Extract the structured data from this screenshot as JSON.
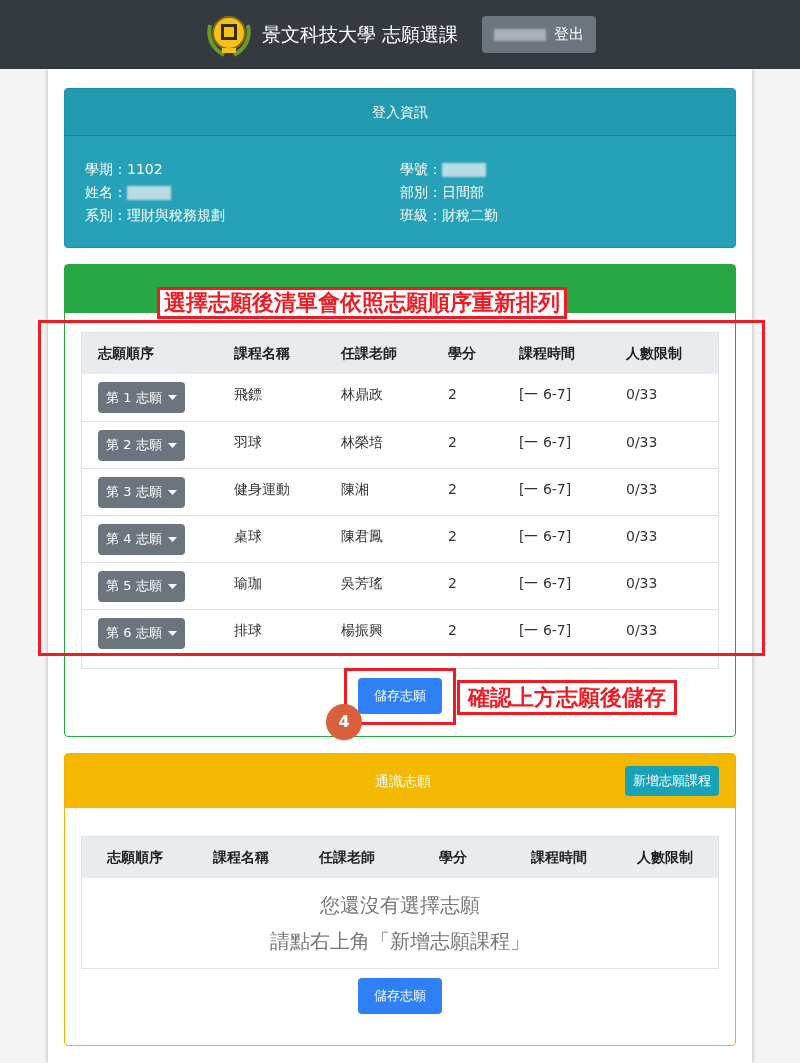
{
  "navbar": {
    "title": "景文科技大學 志願選課",
    "logout_label": "登出"
  },
  "login_info": {
    "title": "登入資訊",
    "fields": [
      {
        "label": "學期：",
        "value": "1102"
      },
      {
        "label": "學號："
      },
      {
        "label": "姓名："
      },
      {
        "label": "部別：",
        "value": "日間部"
      },
      {
        "label": "系別：",
        "value": "理財與稅務規劃"
      },
      {
        "label": "班級：",
        "value": "財稅二勤"
      }
    ]
  },
  "pe_wishes": {
    "columns": [
      "志願順序",
      "課程名稱",
      "任課老師",
      "學分",
      "課程時間",
      "人數限制"
    ],
    "rows": [
      {
        "cells": [
          "第 1 志願",
          "飛鏢",
          "林鼎政",
          "2",
          "[一 6-7]",
          "0/33"
        ]
      },
      {
        "cells": [
          "第 2 志願",
          "羽球",
          "林榮培",
          "2",
          "[一 6-7]",
          "0/33"
        ]
      },
      {
        "cells": [
          "第 3 志願",
          "健身運動",
          "陳湘",
          "2",
          "[一 6-7]",
          "0/33"
        ]
      },
      {
        "cells": [
          "第 4 志願",
          "桌球",
          "陳君鳳",
          "2",
          "[一 6-7]",
          "0/33"
        ]
      },
      {
        "cells": [
          "第 5 志願",
          "瑜珈",
          "吳芳瑤",
          "2",
          "[一 6-7]",
          "0/33"
        ]
      },
      {
        "cells": [
          "第 6 志願",
          "排球",
          "楊振興",
          "2",
          "[一 6-7]",
          "0/33"
        ]
      }
    ],
    "save_label": "儲存志願"
  },
  "general_wishes": {
    "title": "通識志願",
    "add_label": "新增志願課程",
    "columns": [
      "志願順序",
      "課程名稱",
      "任課老師",
      "學分",
      "課程時間",
      "人數限制"
    ],
    "empty_lines": [
      "您還沒有選擇志願",
      "請點右上角「新增志願課程」"
    ],
    "save_label": "儲存志願"
  },
  "annotations": {
    "list_note": "選擇志願後清單會依照志願順序重新排列",
    "save_note": "確認上方志願後儲存",
    "step": "4"
  }
}
